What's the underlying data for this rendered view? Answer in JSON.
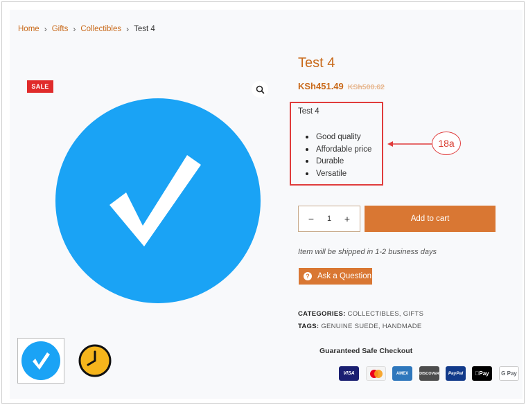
{
  "breadcrumb": {
    "home": "Home",
    "sep": "›",
    "gifts": "Gifts",
    "collectibles": "Collectibles",
    "current": "Test 4"
  },
  "badge": {
    "sale": "SALE"
  },
  "product": {
    "title": "Test 4",
    "price": "KSh451.49",
    "old_price": "KSh500.62",
    "description_title": "Test 4",
    "features": [
      "Good quality",
      "Affordable price",
      "Durable",
      "Versatile"
    ]
  },
  "annotation": {
    "label": "18a",
    "color": "#e03c3c"
  },
  "cart": {
    "quantity": "1",
    "minus": "−",
    "plus": "+",
    "add_label": "Add to cart"
  },
  "shipping_note": "Item will be shipped in 1-2 business days",
  "ask_question": {
    "label": "Ask a Question",
    "icon": "?"
  },
  "meta": {
    "categories_label": "CATEGORIES:",
    "categories": [
      "COLLECTIBLES",
      "GIFTS"
    ],
    "tags_label": "TAGS:",
    "tags": [
      "GENUINE SUEDE",
      "HANDMADE"
    ]
  },
  "checkout": {
    "title": "Guaranteed Safe Checkout",
    "methods": [
      "VISA",
      "mastercard",
      "AMEX",
      "DISCOVER",
      "PayPal",
      "Pay",
      "G Pay"
    ]
  },
  "colors": {
    "accent": "#c96a1b",
    "button": "#d97733",
    "sale": "#e02b2b",
    "check_blue": "#1aa3f5",
    "clock_yellow": "#f6b51c"
  }
}
